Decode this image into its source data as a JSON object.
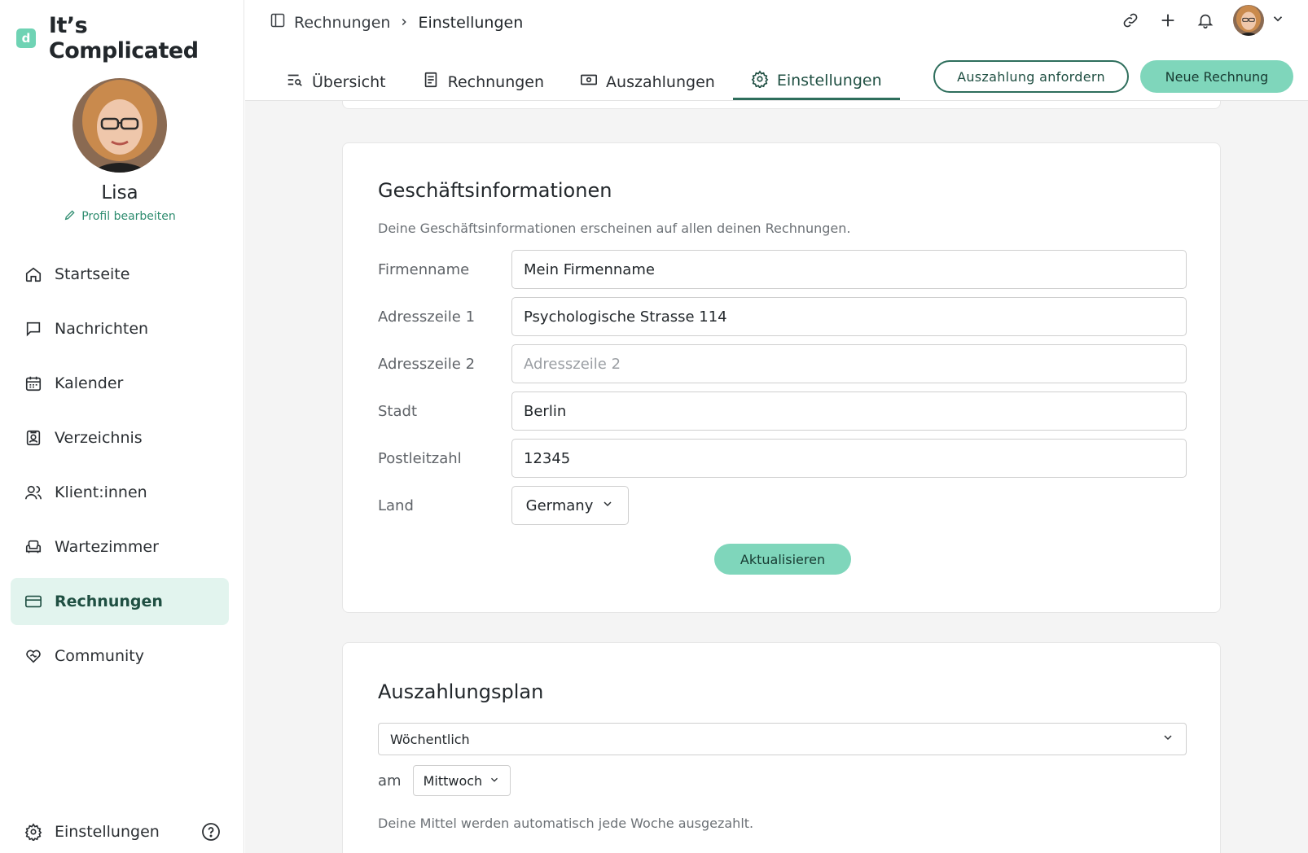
{
  "brand": {
    "logo_letter": "d",
    "name": "It’s Complicated",
    "accent": "#6fd3b4"
  },
  "profile": {
    "name": "Lisa",
    "edit_label": "Profil bearbeiten"
  },
  "sidebar": {
    "items": [
      {
        "label": "Startseite",
        "icon": "home-icon"
      },
      {
        "label": "Nachrichten",
        "icon": "message-icon"
      },
      {
        "label": "Kalender",
        "icon": "calendar-icon"
      },
      {
        "label": "Verzeichnis",
        "icon": "directory-icon"
      },
      {
        "label": "Klient:innen",
        "icon": "clients-icon"
      },
      {
        "label": "Wartezimmer",
        "icon": "armchair-icon"
      },
      {
        "label": "Rechnungen",
        "icon": "credit-card-icon",
        "active": true
      },
      {
        "label": "Community",
        "icon": "heart-hands-icon"
      }
    ],
    "settings_label": "Einstellungen"
  },
  "breadcrumb": {
    "parent": "Rechnungen",
    "current": "Einstellungen"
  },
  "tabs": [
    {
      "label": "Übersicht",
      "icon": "list-search-icon"
    },
    {
      "label": "Rechnungen",
      "icon": "document-icon"
    },
    {
      "label": "Auszahlungen",
      "icon": "banknote-icon"
    },
    {
      "label": "Einstellungen",
      "icon": "gear-icon",
      "active": true
    }
  ],
  "actions": {
    "request_payout": "Auszahlung anfordern",
    "new_invoice": "Neue Rechnung"
  },
  "business": {
    "title": "Geschäftsinformationen",
    "description": "Deine Geschäftsinformationen erscheinen auf allen deinen Rechnungen.",
    "fields": {
      "company": {
        "label": "Firmenname",
        "value": "Mein Firmenname"
      },
      "address1": {
        "label": "Adresszeile 1",
        "value": "Psychologische Strasse 114"
      },
      "address2": {
        "label": "Adresszeile 2",
        "value": "",
        "placeholder": "Adresszeile 2"
      },
      "city": {
        "label": "Stadt",
        "value": "Berlin"
      },
      "zip": {
        "label": "Postleitzahl",
        "value": "12345"
      },
      "country": {
        "label": "Land",
        "value": "Germany"
      }
    },
    "update_label": "Aktualisieren"
  },
  "payout_plan": {
    "title": "Auszahlungsplan",
    "frequency": "Wöchentlich",
    "day_prefix": "am",
    "day": "Mittwoch",
    "note": "Deine Mittel werden automatisch jede Woche ausgezahlt."
  },
  "colors": {
    "accent": "#7fd6bb",
    "primary_dark": "#2e6e5c",
    "active_bg": "#e2f4ee"
  }
}
